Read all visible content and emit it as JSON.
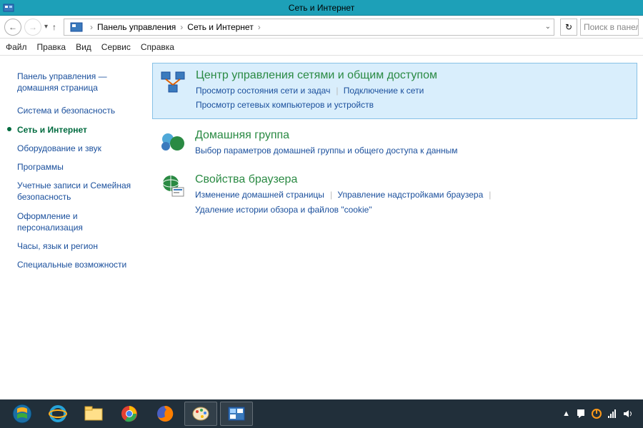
{
  "title": "Сеть и Интернет",
  "nav": {
    "breadcrumb": [
      "Панель управления",
      "Сеть и Интернет"
    ],
    "search_placeholder": "Поиск в панел"
  },
  "menu": [
    "Файл",
    "Правка",
    "Вид",
    "Сервис",
    "Справка"
  ],
  "sidebar": [
    {
      "label": "Панель управления — домашняя страница",
      "active": false
    },
    {
      "label": "Система и безопасность",
      "active": false
    },
    {
      "label": "Сеть и Интернет",
      "active": true
    },
    {
      "label": "Оборудование и звук",
      "active": false
    },
    {
      "label": "Программы",
      "active": false
    },
    {
      "label": "Учетные записи и Семейная безопасность",
      "active": false
    },
    {
      "label": "Оформление и персонализация",
      "active": false
    },
    {
      "label": "Часы, язык и регион",
      "active": false
    },
    {
      "label": "Специальные возможности",
      "active": false
    }
  ],
  "sections": [
    {
      "heading": "Центр управления сетями и общим доступом",
      "links": [
        "Просмотр состояния сети и задач",
        "Подключение к сети",
        "Просмотр сетевых компьютеров и устройств"
      ],
      "selected": true,
      "icon": "network-sharing"
    },
    {
      "heading": "Домашняя группа",
      "links": [
        "Выбор параметров домашней группы и общего доступа к данным"
      ],
      "selected": false,
      "icon": "homegroup"
    },
    {
      "heading": "Свойства браузера",
      "links": [
        "Изменение домашней страницы",
        "Управление надстройками браузера",
        "Удаление истории обзора и файлов \"cookie\""
      ],
      "selected": false,
      "icon": "internet-options"
    }
  ],
  "tray": {
    "up": "▲"
  }
}
